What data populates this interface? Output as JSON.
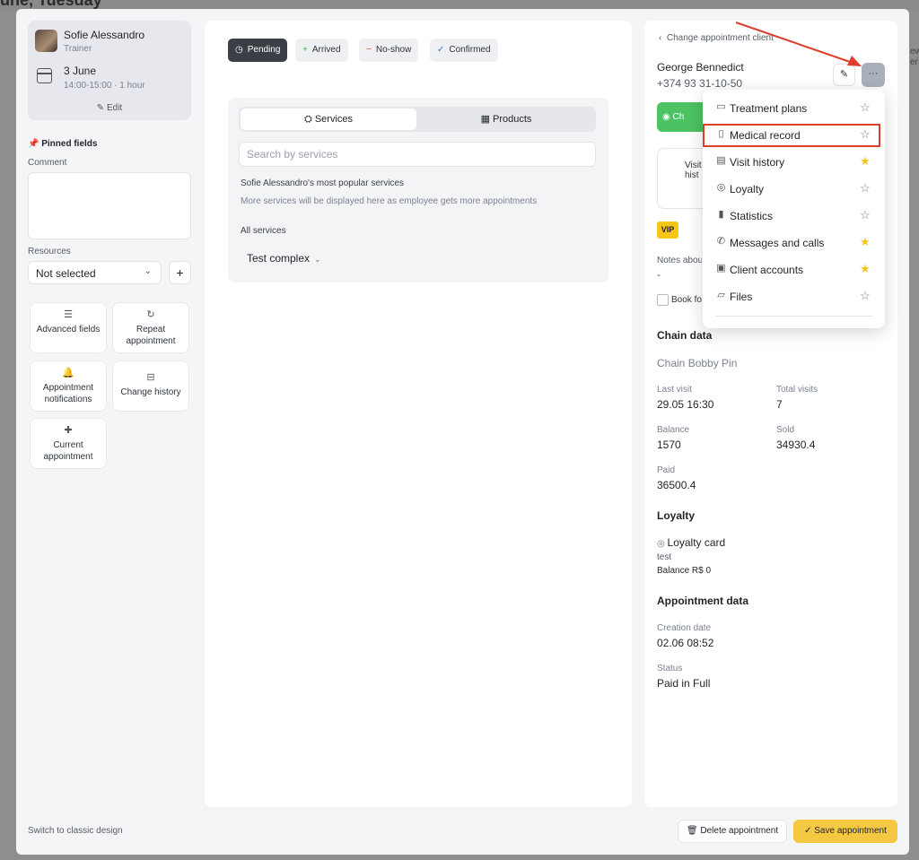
{
  "background": {
    "title": "une, Tuesday",
    "right_text": "ew er"
  },
  "employee": {
    "name": "Sofie Alessandro",
    "role": "Trainer",
    "date": "3 June",
    "time": "14:00-15:00 · 1 hour",
    "edit_label": "Edit"
  },
  "left": {
    "pinned_label": "Pinned fields",
    "comment_label": "Comment",
    "resources_label": "Resources",
    "resources_value": "Not selected",
    "tiles": [
      {
        "icon": "☰",
        "label": "Advanced fields"
      },
      {
        "icon": "↻",
        "label": "Repeat appointment"
      },
      {
        "icon": "🔔",
        "label": "Appointment notifications"
      },
      {
        "icon": "⊟",
        "label": "Change history"
      },
      {
        "icon": "✚",
        "label": "Current appointment"
      }
    ],
    "switch_link": "Switch to classic design"
  },
  "statuses": [
    {
      "icon": "◷",
      "label": "Pending",
      "active": true
    },
    {
      "icon": "+",
      "label": "Arrived",
      "color": "#3cb55a"
    },
    {
      "icon": "−",
      "label": "No-show",
      "color": "#e0443a"
    },
    {
      "icon": "✓",
      "label": "Confirmed",
      "color": "#4a6cf7"
    }
  ],
  "services": {
    "tab_services": "Services",
    "tab_products": "Products",
    "search_placeholder": "Search by services",
    "popular_title": "Sofie Alessandro's most popular services",
    "popular_sub": "More services will be displayed here as employee gets more appointments",
    "all_label": "All services",
    "complex": "Test complex"
  },
  "client": {
    "change_label": "Change appointment client",
    "name": "George Bennedict",
    "phone": "+374 93 31-10-50",
    "wa_label": "Ch",
    "visit_label": "Visit hist",
    "vip": "VIP",
    "notes_label": "Notes abou",
    "notes_value": "-",
    "book_label": "Book fo",
    "chain_title": "Chain data",
    "chain_value": "Chain Bobby Pin",
    "last_visit_label": "Last visit",
    "last_visit": "29.05 16:30",
    "total_visits_label": "Total visits",
    "total_visits": "7",
    "balance_label": "Balance",
    "balance": "1570",
    "sold_label": "Sold",
    "sold": "34930.4",
    "paid_label": "Paid",
    "paid": "36500.4",
    "loyalty_title": "Loyalty",
    "loyalty_card": "Loyalty card",
    "loyalty_test": "test",
    "loyalty_balance": "Balance R$ 0",
    "appt_title": "Appointment data",
    "creation_label": "Creation date",
    "creation": "02.06 08:52",
    "status_label": "Status",
    "status": "Paid in Full"
  },
  "menu": [
    {
      "icon": "▭",
      "label": "Treatment plans",
      "fav": false
    },
    {
      "icon": "▯",
      "label": "Medical record",
      "fav": false
    },
    {
      "icon": "▤",
      "label": "Visit history",
      "fav": true
    },
    {
      "icon": "◎",
      "label": "Loyalty",
      "fav": false
    },
    {
      "icon": "▮",
      "label": "Statistics",
      "fav": false
    },
    {
      "icon": "✆",
      "label": "Messages and calls",
      "fav": true
    },
    {
      "icon": "▣",
      "label": "Client accounts",
      "fav": true
    },
    {
      "icon": "▱",
      "label": "Files",
      "fav": false
    }
  ],
  "footer": {
    "delete_label": "Delete appointment",
    "save_label": "Save appointment"
  },
  "colors": {
    "accent": "#f5c842",
    "highlight": "#e03e2d",
    "favorite": "#f5c518",
    "whatsapp": "#4cc262"
  }
}
